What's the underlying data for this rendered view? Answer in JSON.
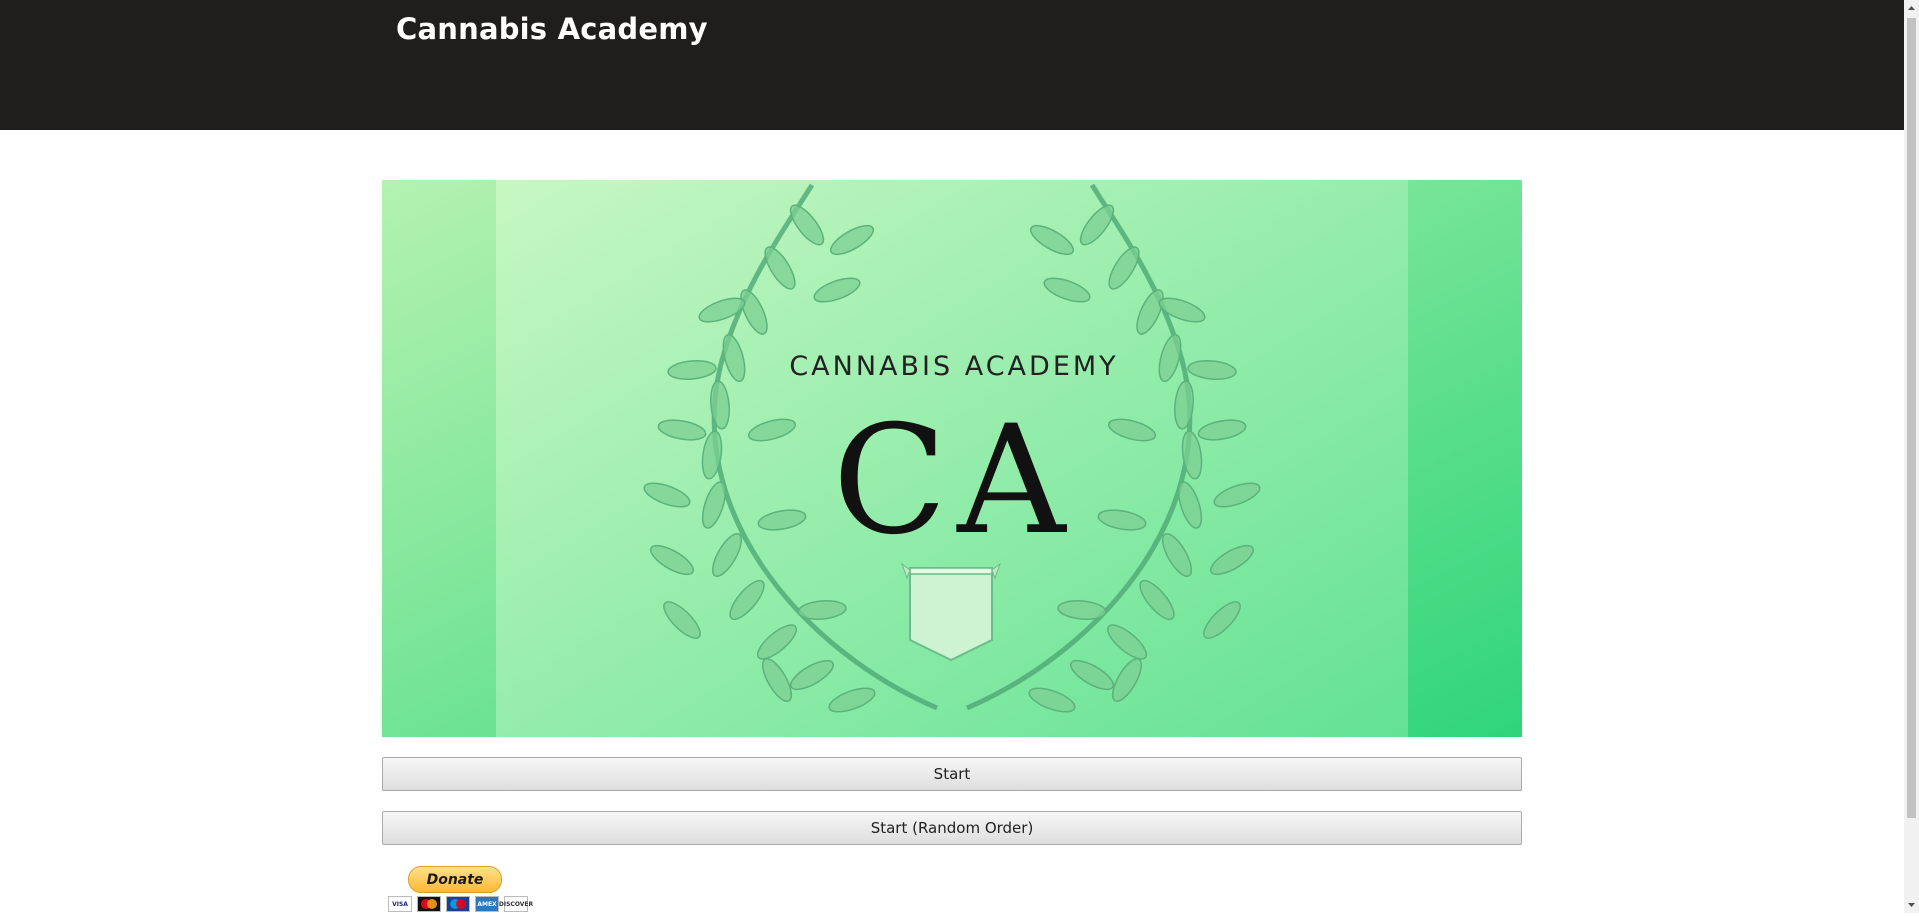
{
  "header": {
    "site_title": "Cannabis Academy"
  },
  "hero": {
    "logo_text": "CANNABIS ACADEMY",
    "monogram": "CA",
    "colors": {
      "background_light": "#c2f5c0",
      "background_dark": "#2fd57a",
      "wreath": "#4ea874",
      "text": "#111111"
    }
  },
  "actions": {
    "start_label": "Start",
    "start_random_label": "Start (Random Order)"
  },
  "donate": {
    "button_label": "Donate",
    "cards": [
      "VISA",
      "mastercard",
      "maestro",
      "AMEX",
      "DISCOVER"
    ]
  }
}
